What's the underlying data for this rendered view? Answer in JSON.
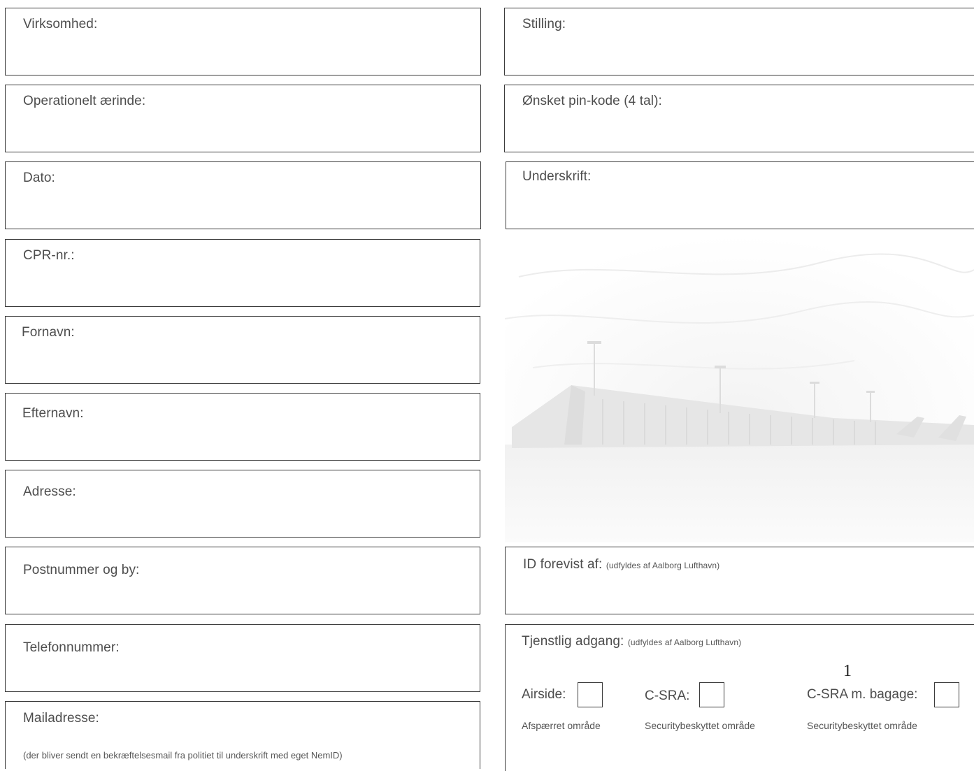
{
  "left_fields": [
    {
      "label": "Virksomhed:"
    },
    {
      "label": "Operationelt ærinde:"
    },
    {
      "label": "Dato:"
    },
    {
      "label": "CPR-nr.:"
    },
    {
      "label": "Fornavn:"
    },
    {
      "label": "Efternavn:"
    },
    {
      "label": "Adresse:"
    },
    {
      "label": "Postnummer og by:"
    },
    {
      "label": "Telefonnummer:"
    },
    {
      "label": "Mailadresse:",
      "hint": "(der bliver sendt en bekræftelsesmail fra politiet til underskrift med eget NemID)"
    }
  ],
  "right_fields": [
    {
      "label": "Stilling:"
    },
    {
      "label": "Ønsket pin-kode (4 tal):"
    },
    {
      "label": "Underskrift:"
    }
  ],
  "id_shown": {
    "label": "ID forevist af:",
    "note": "(udfyldes af Aalborg Lufthavn)"
  },
  "access": {
    "label": "Tjenstlig adgang:",
    "note": "(udfyldes af Aalborg Lufthavn)",
    "options": [
      {
        "label": "Airside:",
        "desc": "Afspærret område"
      },
      {
        "label": "C-SRA:",
        "desc": "Securitybeskyttet område"
      },
      {
        "label": "C-SRA m. bagage:",
        "desc": "Securitybeskyttet område"
      }
    ]
  },
  "page_number": "1",
  "photo_icon": "airport-terminal-illustration"
}
